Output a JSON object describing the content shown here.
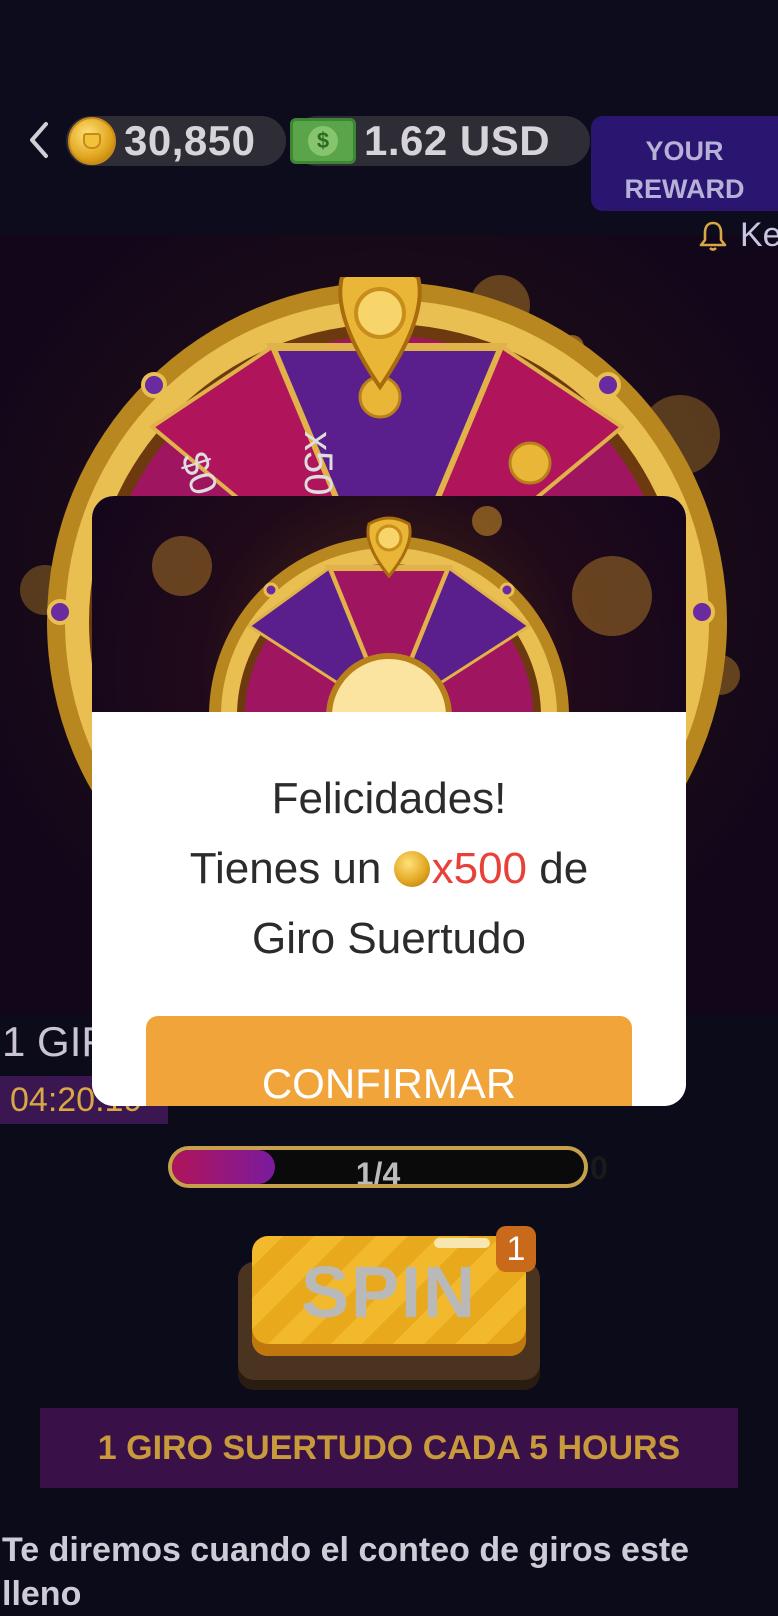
{
  "header": {
    "coins": "30,850",
    "cash": "1.62 USD",
    "cash_symbol": "$",
    "reward_button_line1": "YOUR",
    "reward_button_line2": "REWARD",
    "notify_text": "Ke"
  },
  "wheel": {
    "segment_label_top": "x50",
    "segment_label_left": "$0"
  },
  "giro": {
    "label": "1 GIF",
    "timer": "04:20:19"
  },
  "progress": {
    "text": "1/4",
    "fraction": 0.25,
    "max_label": "0"
  },
  "spin": {
    "label": "SPIN",
    "badge": "1"
  },
  "info": {
    "cada": "1 GIRO SUERTUDO CADA 5 HOURS",
    "footer": "Te diremos cuando el conteo de giros este lleno"
  },
  "modal": {
    "title": "Felicidades!",
    "line_prefix": "Tienes un",
    "amount": "x500",
    "line_suffix": "de",
    "line3": "Giro Suertudo",
    "confirm": "CONFIRMAR"
  },
  "colors": {
    "background": "#0c0b1a",
    "accent_gold": "#c89a3b",
    "confirm": "#f0a43a",
    "reward_button": "#2a1670",
    "amount_red": "#e8413a"
  }
}
